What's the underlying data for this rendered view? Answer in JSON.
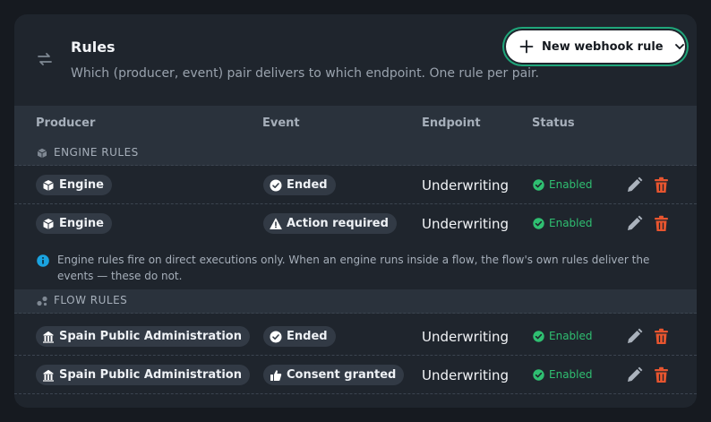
{
  "header": {
    "title": "Rules",
    "subtitle": "Which (producer, event) pair delivers to which endpoint. One rule per pair.",
    "new_button_label": "New webhook rule"
  },
  "columns": [
    "Producer",
    "Event",
    "Endpoint",
    "Status"
  ],
  "sections": [
    {
      "label": "ENGINE RULES",
      "rows": [
        {
          "producer": "Engine",
          "event": "Ended",
          "endpoint": "Underwriting",
          "status": "Enabled"
        },
        {
          "producer": "Engine",
          "event": "Action required",
          "endpoint": "Underwriting",
          "status": "Enabled"
        }
      ],
      "note": "Engine rules fire on direct executions only. When an engine runs inside a flow, the flow's own rules deliver the events — these do not."
    },
    {
      "label": "FLOW RULES",
      "rows": [
        {
          "producer": "Spain Public Administration",
          "event": "Ended",
          "endpoint": "Underwriting",
          "status": "Enabled"
        },
        {
          "producer": "Spain Public Administration",
          "event": "Consent granted",
          "endpoint": "Underwriting",
          "status": "Enabled"
        }
      ]
    }
  ],
  "colors": {
    "accent": "#1fa67a",
    "enabled": "#2fbf71",
    "delete": "#e8552f",
    "info": "#1aa3e0"
  },
  "icons": {
    "header": "arrows-swap-icon",
    "engine_producer": "cube-icon",
    "flow_producer": "building-icon",
    "ended_event": "check-circle-icon",
    "action_event": "warning-triangle-icon",
    "consent_event": "thumbs-up-icon",
    "status": "check-circle-icon",
    "edit": "pencil-icon",
    "delete": "trash-icon",
    "note": "info-icon"
  }
}
